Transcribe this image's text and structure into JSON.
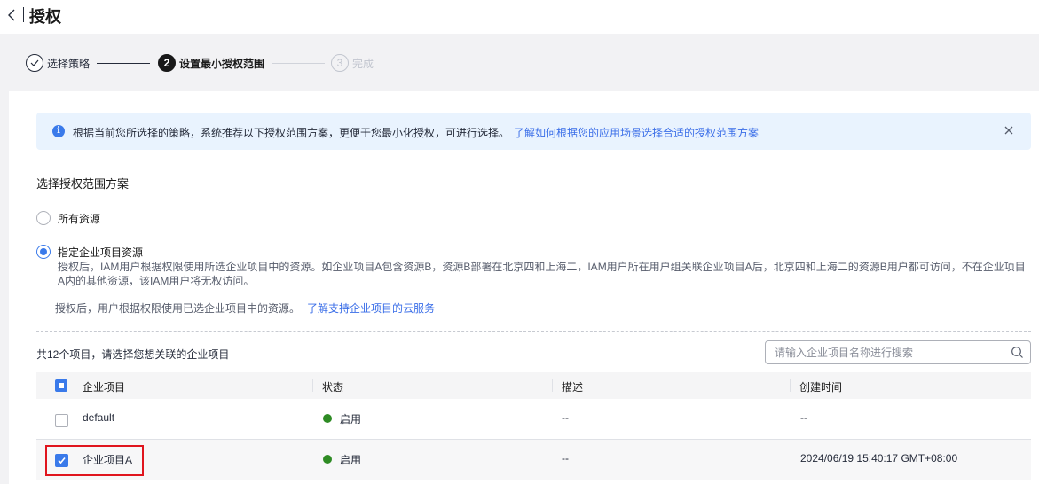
{
  "header": {
    "title": "授权"
  },
  "steps": [
    {
      "number": "",
      "label": "选择策略",
      "state": "done"
    },
    {
      "number": "2",
      "label": "设置最小授权范围",
      "state": "active"
    },
    {
      "number": "3",
      "label": "完成",
      "state": "pending"
    }
  ],
  "alert": {
    "text": "根据当前您所选择的策略，系统推荐以下授权范围方案，更便于您最小化授权，可进行选择。",
    "link": "了解如何根据您的应用场景选择合适的授权范围方案"
  },
  "scope": {
    "title": "选择授权范围方案",
    "options": [
      {
        "label": "所有资源",
        "selected": false
      },
      {
        "label": "指定企业项目资源",
        "selected": true
      }
    ],
    "description": "授权后，IAM用户根据权限使用所选企业项目中的资源。如企业项目A包含资源B，资源B部署在北京四和上海二，IAM用户所在用户组关联企业项目A后，北京四和上海二的资源B用户都可访问，不在企业项目A内的其他资源，该IAM用户将无权访问。",
    "note": "授权后，用户根据权限使用已选企业项目中的资源。",
    "note_link": "了解支持企业项目的云服务"
  },
  "list": {
    "count_text": "共12个项目，请选择您想关联的企业项目",
    "search_placeholder": "请输入企业项目名称进行搜索",
    "columns": [
      "企业项目",
      "状态",
      "描述",
      "创建时间"
    ],
    "rows": [
      {
        "name": "default",
        "status": "启用",
        "desc": "--",
        "created": "--",
        "checked": false
      },
      {
        "name": "企业项目A",
        "status": "启用",
        "desc": "--",
        "created": "2024/06/19 15:40:17 GMT+08:00",
        "checked": true
      }
    ]
  },
  "colors": {
    "accent": "#3a7aea",
    "link": "#3a6ee8",
    "status_enabled": "#2e8b24",
    "highlight": "#e0151e"
  }
}
